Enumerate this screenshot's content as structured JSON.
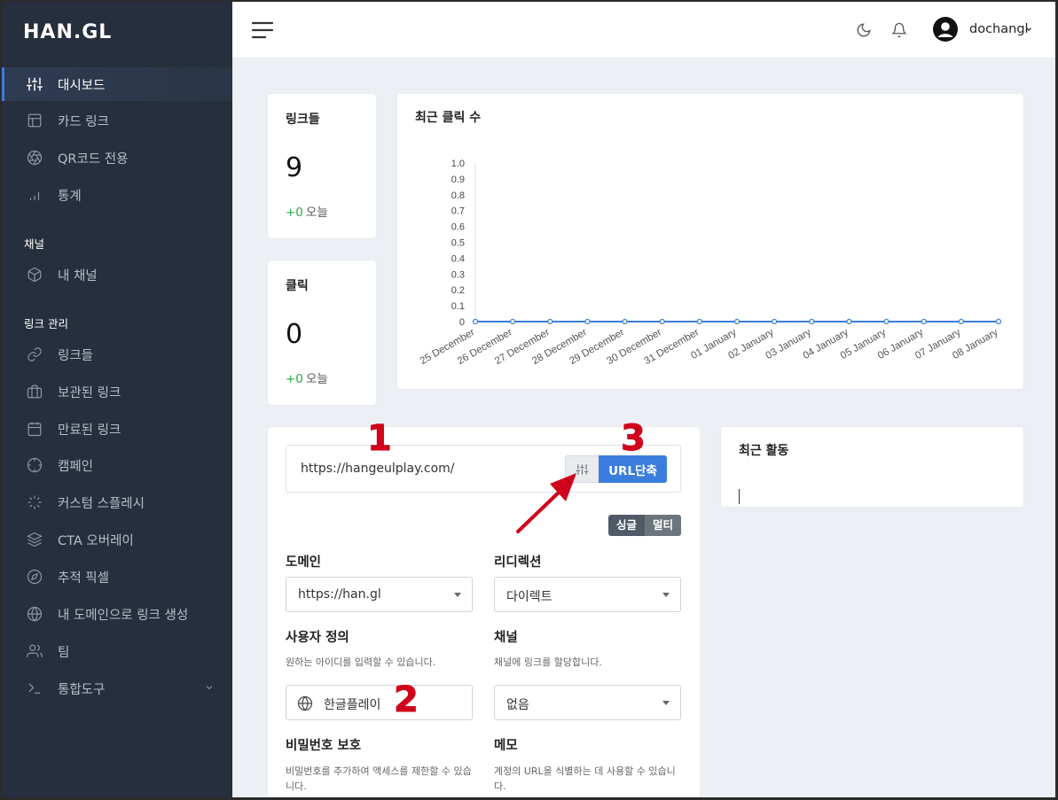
{
  "app": {
    "logo": "HAN.GL"
  },
  "sidebar": {
    "items": [
      {
        "label": "대시보드",
        "icon": "sliders-icon",
        "active": true
      },
      {
        "label": "카드 링크",
        "icon": "layout-icon"
      },
      {
        "label": "QR코드 전용",
        "icon": "aperture-icon"
      },
      {
        "label": "통계",
        "icon": "bar-chart-icon"
      }
    ],
    "section_channel": "채널",
    "channel_items": [
      {
        "label": "내 채널",
        "icon": "box-icon"
      }
    ],
    "section_links": "링크 관리",
    "link_items": [
      {
        "label": "링크들",
        "icon": "link-icon"
      },
      {
        "label": "보관된 링크",
        "icon": "briefcase-icon"
      },
      {
        "label": "만료된 링크",
        "icon": "calendar-icon"
      },
      {
        "label": "캠페인",
        "icon": "crosshair-icon"
      },
      {
        "label": "커스텀 스플레시",
        "icon": "loader-icon"
      },
      {
        "label": "CTA 오버레이",
        "icon": "layers-icon"
      },
      {
        "label": "추적 픽셀",
        "icon": "compass-icon"
      },
      {
        "label": "내 도메인으로 링크 생성",
        "icon": "globe-icon"
      },
      {
        "label": "팀",
        "icon": "users-icon"
      },
      {
        "label": "통합도구",
        "icon": "terminal-icon"
      }
    ]
  },
  "topbar": {
    "username": "dochangl"
  },
  "stats": {
    "links": {
      "title": "링크들",
      "value": "9",
      "delta": "+0",
      "delta_suffix": "오늘"
    },
    "clicks": {
      "title": "클릭",
      "value": "0",
      "delta": "+0",
      "delta_suffix": "오늘"
    }
  },
  "chart_data": {
    "type": "line",
    "title": "최근 클릭 수",
    "categories": [
      "25 December",
      "26 December",
      "27 December",
      "28 December",
      "29 December",
      "30 December",
      "31 December",
      "01 January",
      "02 January",
      "03 January",
      "04 January",
      "05 January",
      "06 January",
      "07 January",
      "08 January"
    ],
    "values": [
      0,
      0,
      0,
      0,
      0,
      0,
      0,
      0,
      0,
      0,
      0,
      0,
      0,
      0,
      0
    ],
    "yticks": [
      "1.0",
      "0.9",
      "0.8",
      "0.7",
      "0.6",
      "0.5",
      "0.4",
      "0.3",
      "0.2",
      "0.1",
      "0"
    ],
    "ylim": [
      0,
      1
    ],
    "line_color": "#3b7ddd"
  },
  "form": {
    "url_value": "https://hangeulplay.com/",
    "shorten_label": "URL단축",
    "toggle_single": "싱글",
    "toggle_multi": "멀티",
    "domain_label": "도메인",
    "domain_value": "https://han.gl",
    "redirect_label": "리디렉션",
    "redirect_value": "다이렉트",
    "custom_label": "사용자 정의",
    "custom_help": "원하는 아이디를 입력할 수 있습니다.",
    "custom_value": "한글플레이",
    "channel_label": "채널",
    "channel_help": "채널에 링크를 할당합니다.",
    "channel_value": "없음",
    "password_label": "비밀번호 보호",
    "password_help": "비밀번호를 추가하여 액세스를 제한할 수 있습니다.",
    "memo_label": "메모",
    "memo_help": "계정의 URL을 식별하는 데 사용할 수 있습니다."
  },
  "activity": {
    "title": "최근 활동"
  },
  "annotations": {
    "one": "1",
    "two": "2",
    "three": "3",
    "color": "#d0021b"
  }
}
